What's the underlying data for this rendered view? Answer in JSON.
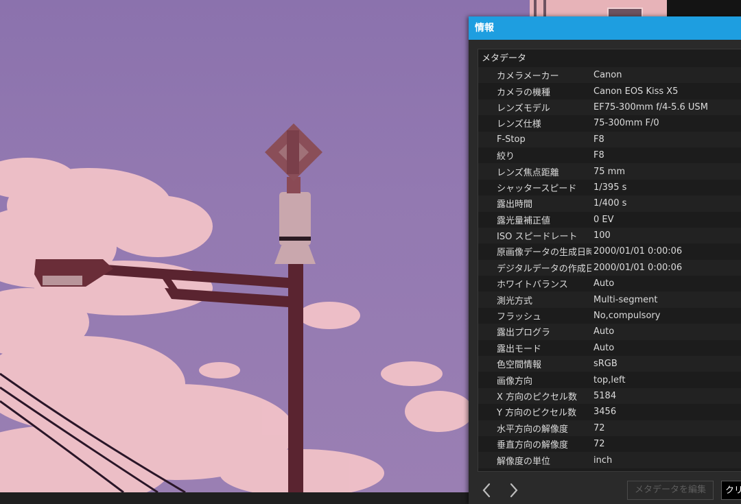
{
  "panel": {
    "title": "情報",
    "section_title": "メタデータ",
    "metadata": [
      {
        "key": "カメラメーカー",
        "value": "Canon"
      },
      {
        "key": "カメラの機種",
        "value": "Canon EOS Kiss X5"
      },
      {
        "key": "レンズモデル",
        "value": "EF75-300mm f/4-5.6 USM"
      },
      {
        "key": "レンズ仕様",
        "value": "75-300mm F/0"
      },
      {
        "key": "F-Stop",
        "value": "F8"
      },
      {
        "key": "絞り",
        "value": "F8"
      },
      {
        "key": "レンズ焦点距離",
        "value": "75 mm"
      },
      {
        "key": "シャッタースピード",
        "value": "1/395 s"
      },
      {
        "key": "露出時間",
        "value": "1/400 s"
      },
      {
        "key": "露光量補正値",
        "value": "0 EV"
      },
      {
        "key": "ISO スピードレート",
        "value": "100"
      },
      {
        "key": "原画像データの生成日時",
        "value": "2000/01/01 0:00:06"
      },
      {
        "key": "デジタルデータの作成日時",
        "value": "2000/01/01 0:00:06"
      },
      {
        "key": "ホワイトバランス",
        "value": "Auto"
      },
      {
        "key": "測光方式",
        "value": "Multi-segment"
      },
      {
        "key": "フラッシュ",
        "value": "No,compulsory"
      },
      {
        "key": "露出プログラ",
        "value": "Auto"
      },
      {
        "key": "露出モード",
        "value": "Auto"
      },
      {
        "key": "色空間情報",
        "value": "sRGB"
      },
      {
        "key": "画像方向",
        "value": "top,left"
      },
      {
        "key": "X 方向のピクセル数",
        "value": "5184"
      },
      {
        "key": "Y 方向のピクセル数",
        "value": "3456"
      },
      {
        "key": "水平方向の解像度",
        "value": "72"
      },
      {
        "key": "垂直方向の解像度",
        "value": "72"
      },
      {
        "key": "解像度の単位",
        "value": "inch"
      }
    ],
    "footer": {
      "edit_label": "メタデータを編集",
      "clear_label": "クリ"
    }
  },
  "icons": {
    "prev": "chevron-left-icon",
    "next": "chevron-right-icon"
  },
  "colors": {
    "title_bar": "#1e9ee0",
    "sky": "#8b72ad",
    "panel_bg": "#2a2a2a"
  }
}
